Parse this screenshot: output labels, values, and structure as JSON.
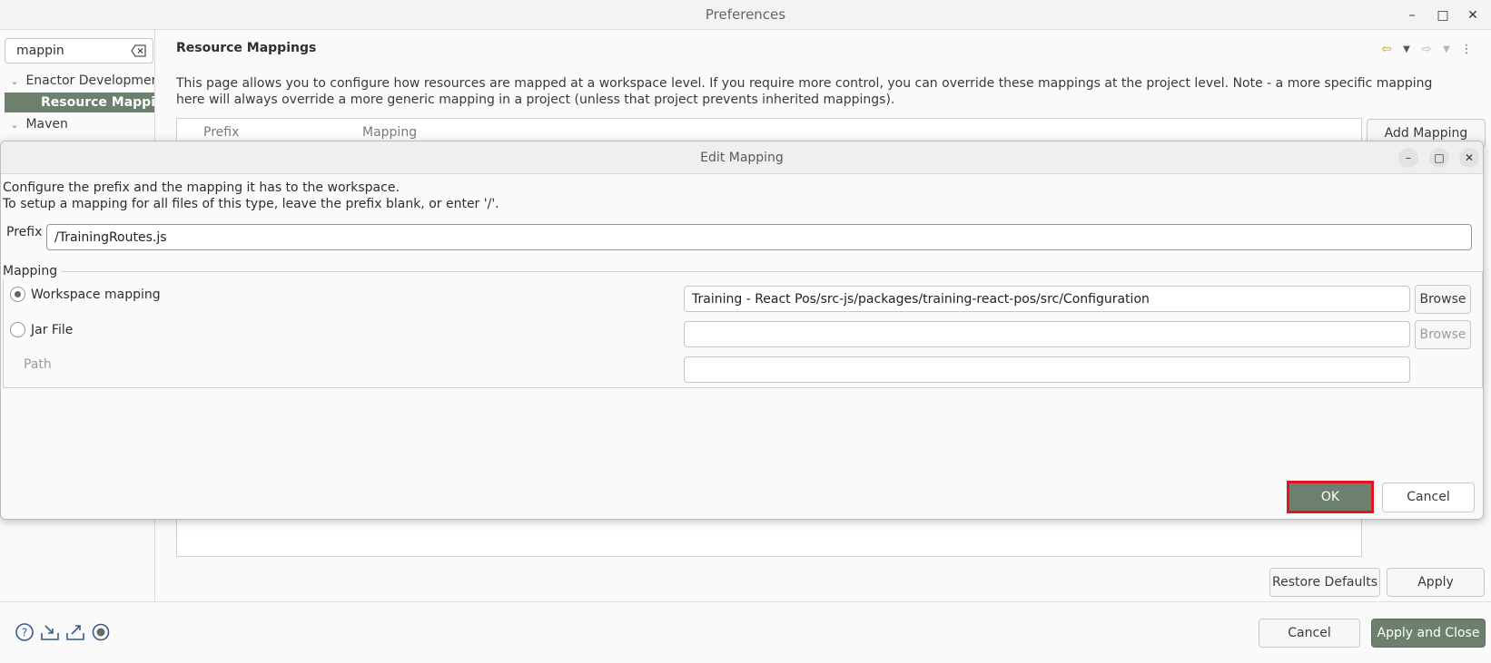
{
  "window": {
    "title": "Preferences",
    "controls": {
      "minimize": "–",
      "maximize": "□",
      "close": "✕"
    }
  },
  "sidebar": {
    "filter_value": "mappin",
    "items": [
      {
        "label": "Enactor Development",
        "expanded": true
      },
      {
        "label": "Resource Mappings",
        "selected": true
      },
      {
        "label": "Maven",
        "expanded": true
      }
    ]
  },
  "page": {
    "title": "Resource Mappings",
    "description": "This page allows you to configure how resources are mapped at a workspace level. If you require more control, you can override these mappings at the project level. Note - a more specific mapping here will always override a more generic mapping in a project (unless that project prevents inherited mappings).",
    "table": {
      "columns": [
        "Prefix",
        "Mapping"
      ]
    },
    "add_mapping_label": "Add Mapping",
    "restore_defaults_label": "Restore Defaults",
    "apply_label": "Apply"
  },
  "footer": {
    "cancel_label": "Cancel",
    "apply_close_label": "Apply and Close"
  },
  "dialog": {
    "title": "Edit Mapping",
    "description_line1": "Configure the prefix and the mapping it has to the workspace.",
    "description_line2": "To setup a mapping for all files of this type, leave the prefix blank, or enter '/'.",
    "prefix_label": "Prefix",
    "prefix_value": "/TrainingRoutes.js",
    "mapping_group_label": "Mapping",
    "workspace_mapping_label": "Workspace mapping",
    "workspace_mapping_value": "Training - React Pos/src-js/packages/training-react-pos/src/Configuration",
    "jar_file_label": "Jar File",
    "jar_file_value": "",
    "path_label": "Path",
    "path_value": "",
    "browse_label": "Browse",
    "ok_label": "OK",
    "cancel_label": "Cancel"
  },
  "colors": {
    "accent": "#6d7f6d",
    "highlight_border": "#e0151f"
  }
}
